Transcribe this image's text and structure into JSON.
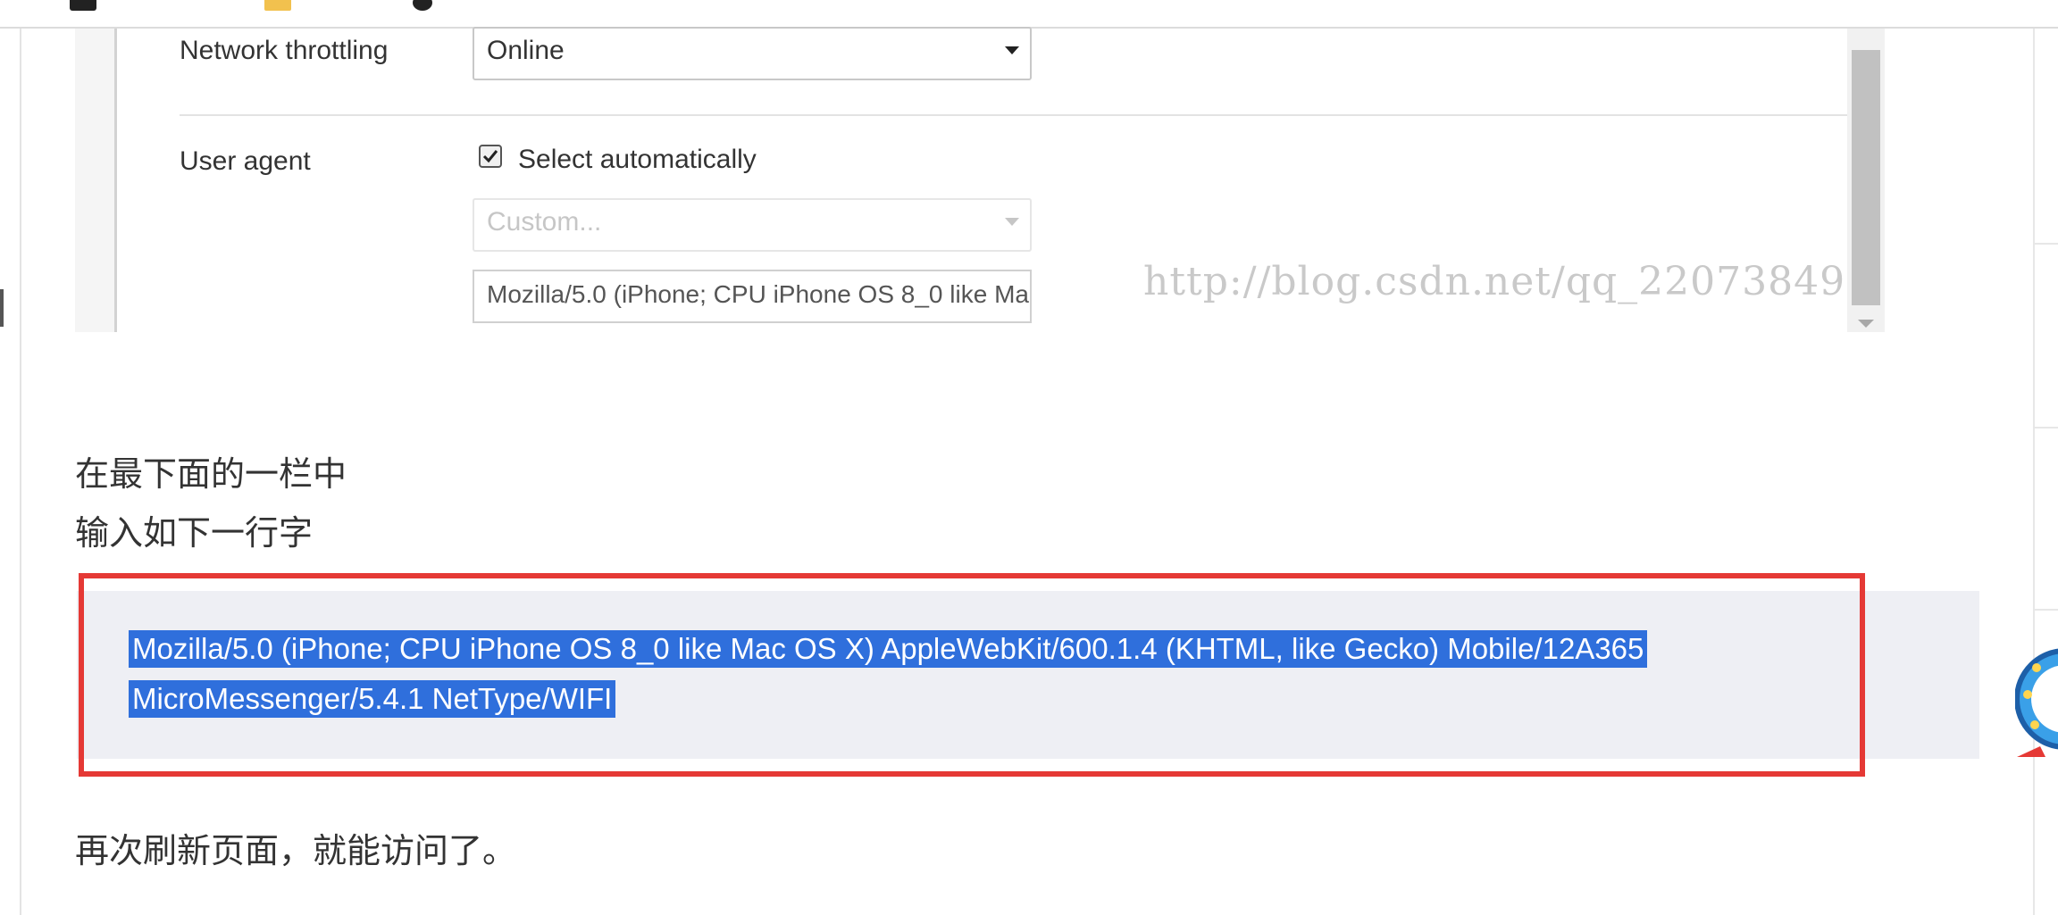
{
  "devtools": {
    "network_label": "Network throttling",
    "network_value": "Online",
    "ua_label": "User agent",
    "ua_checkbox_label": "Select automatically",
    "ua_checked": true,
    "custom_placeholder": "Custom...",
    "ua_value": "Mozilla/5.0 (iPhone; CPU iPhone OS 8_0 like Mac OS X)"
  },
  "watermark": "http://blog.csdn.net/qq_22073849",
  "article": {
    "line1": "在最下面的一栏中",
    "line2": "输入如下一行字",
    "code_line1": "Mozilla/5.0 (iPhone; CPU iPhone OS 8_0 like Mac OS X) AppleWebKit/600.1.4 (KHTML, like Gecko) Mobile/12A365",
    "code_line2": "MicroMessenger/5.4.1 NetType/WIFI",
    "line3": "再次刷新页面，就能访问了。"
  },
  "colors": {
    "highlight": "#2f6fdc",
    "annotation_border": "#e53935",
    "code_background": "#eeeff4"
  }
}
